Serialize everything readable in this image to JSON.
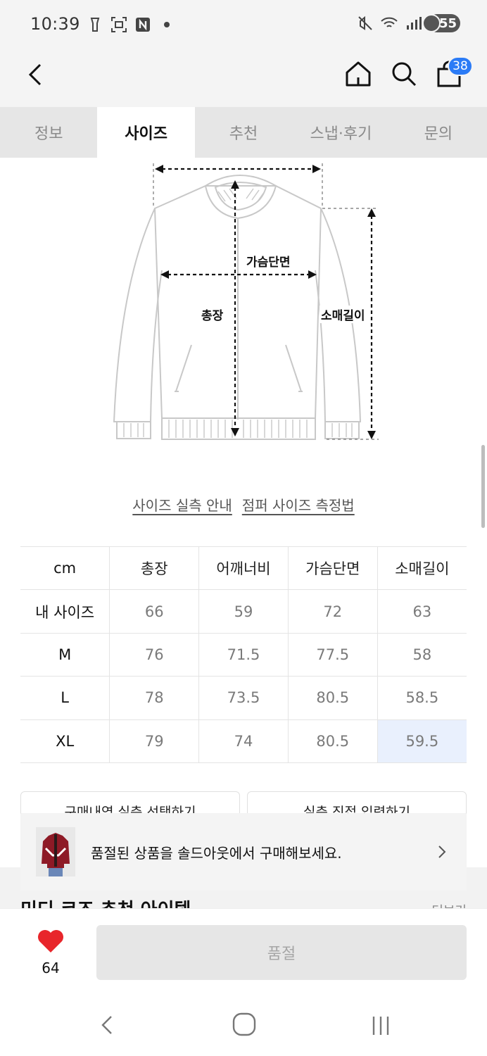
{
  "status": {
    "time": "10:39",
    "battery": "55",
    "icons": [
      "flashlight-icon",
      "screen-scan-icon",
      "n-app-icon",
      "dot-icon",
      "mute-icon",
      "wifi-icon",
      "signal-icon",
      "battery-icon"
    ]
  },
  "header": {
    "cart_count": "38",
    "icons": [
      "back-arrow-icon",
      "home-icon",
      "search-icon",
      "bag-icon"
    ]
  },
  "tabs": [
    {
      "label": "정보",
      "active": false
    },
    {
      "label": "사이즈",
      "active": true
    },
    {
      "label": "추천",
      "active": false
    },
    {
      "label": "스냅·후기",
      "active": false
    },
    {
      "label": "문의",
      "active": false
    }
  ],
  "diagram": {
    "chest_label": "가슴단면",
    "length_label": "총장",
    "sleeve_label": "소매길이"
  },
  "guide_links": {
    "actual_size": "사이즈 실측 안내",
    "how_to_measure": "점퍼 사이즈 측정법"
  },
  "size_table": {
    "headers": [
      "cm",
      "총장",
      "어깨너비",
      "가슴단면",
      "소매길이"
    ],
    "rows": [
      [
        "내 사이즈",
        "66",
        "59",
        "72",
        "63"
      ],
      [
        "M",
        "76",
        "71.5",
        "77.5",
        "58"
      ],
      [
        "L",
        "78",
        "73.5",
        "80.5",
        "58.5"
      ],
      [
        "XL",
        "79",
        "74",
        "80.5",
        "59.5"
      ]
    ],
    "highlight_color": "#e9f0fd"
  },
  "measure_buttons": {
    "left": "구매내역 실측 선택하기",
    "right": "실측 직접 입력하기"
  },
  "soldout_banner": {
    "text": "품절된 상품을 솔드아웃에서 구매해보세요."
  },
  "section_peek": {
    "title": "미디 코즈 추천 아이템",
    "more": "더보기"
  },
  "bottom_bar": {
    "like_count": "64",
    "soldout_label": "품절",
    "heart_color": "#e8262b"
  },
  "colors": {
    "accent_blue": "#2b7bf6",
    "tab_bg": "#e6e6e6"
  }
}
